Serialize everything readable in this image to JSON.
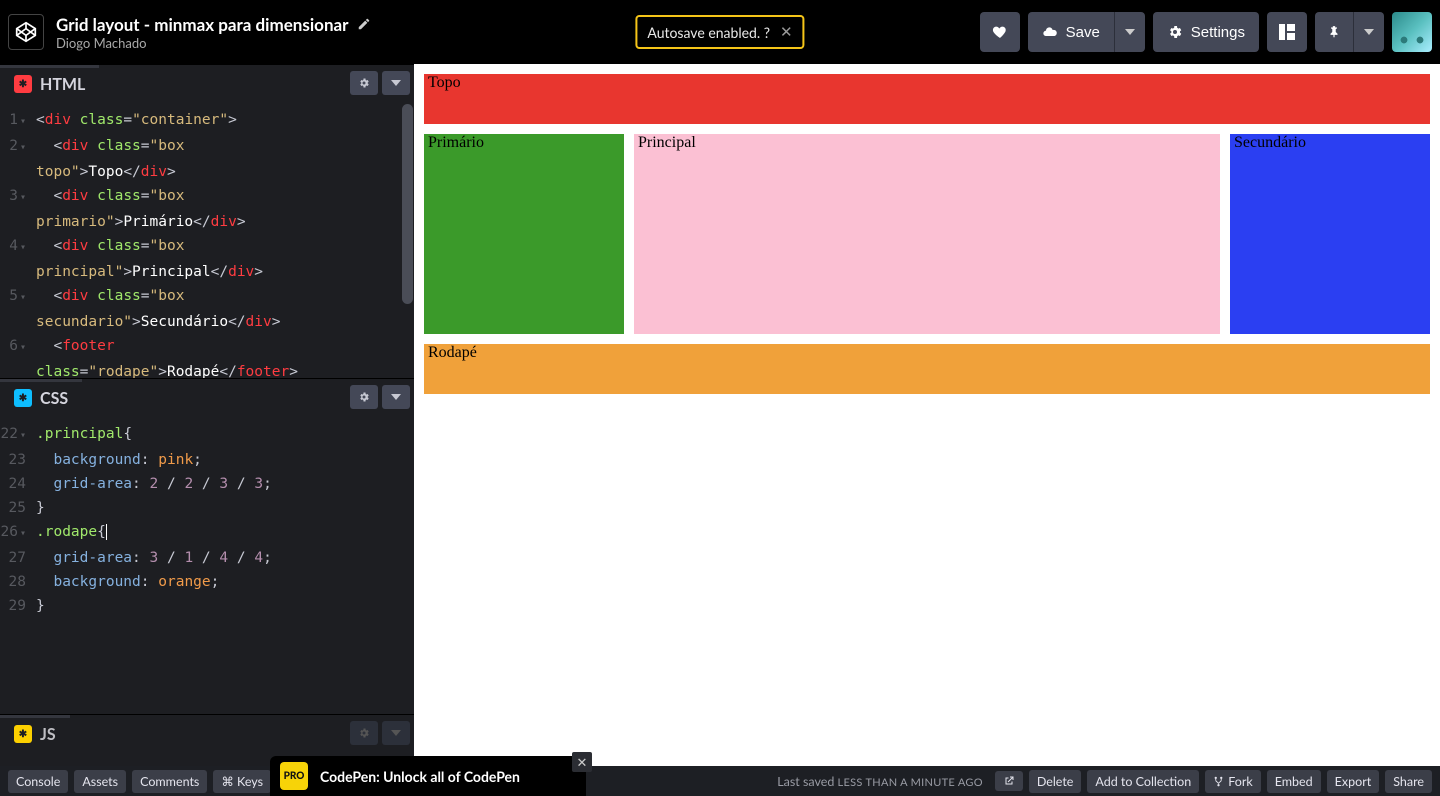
{
  "header": {
    "title": "Grid layout - minmax para dimensionar",
    "author": "Diogo Machado",
    "autosave": "Autosave enabled. ?",
    "save": "Save",
    "settings": "Settings"
  },
  "panels": {
    "html": "HTML",
    "css": "CSS",
    "js": "JS"
  },
  "html_lines": {
    "l1": [
      "1",
      "<div class=\"container\">"
    ],
    "l2": [
      "2",
      "  <div class=\"box topo\">Topo</div>"
    ],
    "l3": [
      "3",
      "  <div class=\"box primario\">Primário</div>"
    ],
    "l4": [
      "4",
      "  <div class=\"box principal\">Principal</div>"
    ],
    "l5": [
      "5",
      "  <div class=\"box secundario\">Secundário</div>"
    ],
    "l6": [
      "6",
      "  <footer class=\"rodape\">Rodapé</footer>"
    ]
  },
  "css_lines": {
    "l22": [
      "22",
      ".principal{"
    ],
    "l23": [
      "23",
      "  background: pink;"
    ],
    "l24": [
      "24",
      "  grid-area: 2 / 2 / 3 / 3;"
    ],
    "l25": [
      "25",
      "}"
    ],
    "l26": [
      "26",
      ".rodape{"
    ],
    "l27": [
      "27",
      "  grid-area: 3 / 1 / 4 / 4;"
    ],
    "l28": [
      "28",
      "  background: orange;"
    ],
    "l29": [
      "29",
      "}"
    ]
  },
  "preview": {
    "topo": "Topo",
    "primario": "Primário",
    "principal": "Principal",
    "secundario": "Secundário",
    "rodape": "Rodapé"
  },
  "footer": {
    "console": "Console",
    "assets": "Assets",
    "comments": "Comments",
    "keys": "⌘ Keys",
    "saved_prefix": "Last saved ",
    "saved_ago": "LESS THAN A MINUTE AGO",
    "delete": "Delete",
    "add": "Add to Collection",
    "fork": "Fork",
    "embed": "Embed",
    "export": "Export",
    "share": "Share"
  },
  "promo": {
    "badge": "PRO",
    "text": "CodePen: Unlock all of CodePen"
  }
}
